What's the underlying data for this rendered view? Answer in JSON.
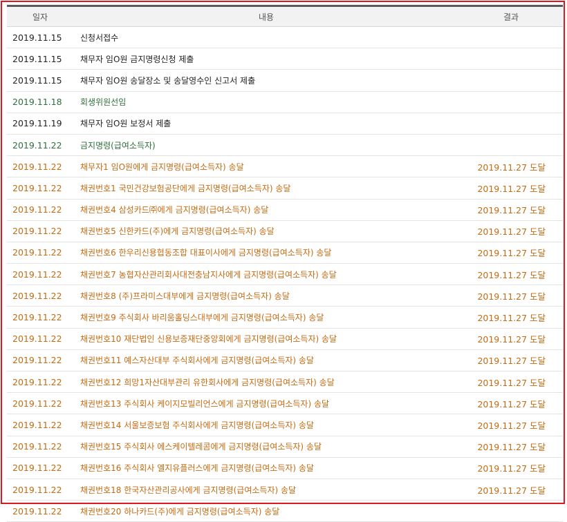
{
  "header": {
    "date": "일자",
    "content": "내용",
    "result": "결과"
  },
  "colors": {
    "border": "#e0161e",
    "black": "#222222",
    "green": "#2e6e3a",
    "orange": "#c56a10"
  },
  "rows": [
    {
      "date": "2019.11.15",
      "content": "신청서접수",
      "result": "",
      "color": "black"
    },
    {
      "date": "2019.11.15",
      "content": "채무자 임O원 금지명령신청 제출",
      "result": "",
      "color": "black"
    },
    {
      "date": "2019.11.15",
      "content": "채무자 임O원 송달장소 및 송달영수인 신고서 제출",
      "result": "",
      "color": "black"
    },
    {
      "date": "2019.11.18",
      "content": "회생위원선임",
      "result": "",
      "color": "green"
    },
    {
      "date": "2019.11.19",
      "content": "채무자 임O원 보정서 제출",
      "result": "",
      "color": "black"
    },
    {
      "date": "2019.11.22",
      "content": "금지명령(급여소득자)",
      "result": "",
      "color": "green"
    },
    {
      "date": "2019.11.22",
      "content": "채무자1 임O원에게 금지명령(급여소득자) 송달",
      "result": "2019.11.27 도달",
      "color": "orange"
    },
    {
      "date": "2019.11.22",
      "content": "채권번호1 국민건강보험공단에게 금지명령(급여소득자) 송달",
      "result": "2019.11.27 도달",
      "color": "orange"
    },
    {
      "date": "2019.11.22",
      "content": "채권번호4 삼성카드㈜에게 금지명령(급여소득자) 송달",
      "result": "2019.11.27 도달",
      "color": "orange"
    },
    {
      "date": "2019.11.22",
      "content": "채권번호5 신한카드(주)에게 금지명령(급여소득자) 송달",
      "result": "2019.11.27 도달",
      "color": "orange"
    },
    {
      "date": "2019.11.22",
      "content": "채권번호6 한우리신용협동조합 대표이사에게 금지명령(급여소득자) 송달",
      "result": "2019.11.27 도달",
      "color": "orange"
    },
    {
      "date": "2019.11.22",
      "content": "채권번호7 농협자산관리회사대전충남지사에게 금지명령(급여소득자) 송달",
      "result": "2019.11.27 도달",
      "color": "orange"
    },
    {
      "date": "2019.11.22",
      "content": "채권번호8 (주)프라미스대부에게 금지명령(급여소득자) 송달",
      "result": "2019.11.27 도달",
      "color": "orange"
    },
    {
      "date": "2019.11.22",
      "content": "채권번호9 주식회사 바리움홀딩스대부에게 금지명령(급여소득자) 송달",
      "result": "2019.11.27 도달",
      "color": "orange"
    },
    {
      "date": "2019.11.22",
      "content": "채권번호10 재단법인 신용보증재단중앙회에게 금지명령(급여소득자) 송달",
      "result": "2019.11.27 도달",
      "color": "orange"
    },
    {
      "date": "2019.11.22",
      "content": "채권번호11 예스자산대부 주식회사에게 금지명령(급여소득자) 송달",
      "result": "2019.11.27 도달",
      "color": "orange"
    },
    {
      "date": "2019.11.22",
      "content": "채권번호12 희망1자산대부관리 유한회사에게 금지명령(급여소득자) 송달",
      "result": "2019.11.27 도달",
      "color": "orange"
    },
    {
      "date": "2019.11.22",
      "content": "채권번호13 주식회사 케이지모빌리언스에게 금지명령(급여소득자) 송달",
      "result": "2019.11.27 도달",
      "color": "orange"
    },
    {
      "date": "2019.11.22",
      "content": "채권번호14 서울보증보험 주식회사에게 금지명령(급여소득자) 송달",
      "result": "2019.11.27 도달",
      "color": "orange"
    },
    {
      "date": "2019.11.22",
      "content": "채권번호15 주식회사 에스케이텔레콤에게 금지명령(급여소득자) 송달",
      "result": "2019.11.27 도달",
      "color": "orange"
    },
    {
      "date": "2019.11.22",
      "content": "채권번호16 주식회사 엘지유플러스에게 금지명령(급여소득자) 송달",
      "result": "2019.11.27 도달",
      "color": "orange"
    },
    {
      "date": "2019.11.22",
      "content": "채권번호18 한국자산관리공사에게 금지명령(급여소득자) 송달",
      "result": "2019.11.27 도달",
      "color": "orange"
    },
    {
      "date": "2019.11.22",
      "content": "채권번호20 하나카드(주)에게 금지명령(급여소득자) 송달",
      "result": "",
      "color": "orange"
    }
  ]
}
